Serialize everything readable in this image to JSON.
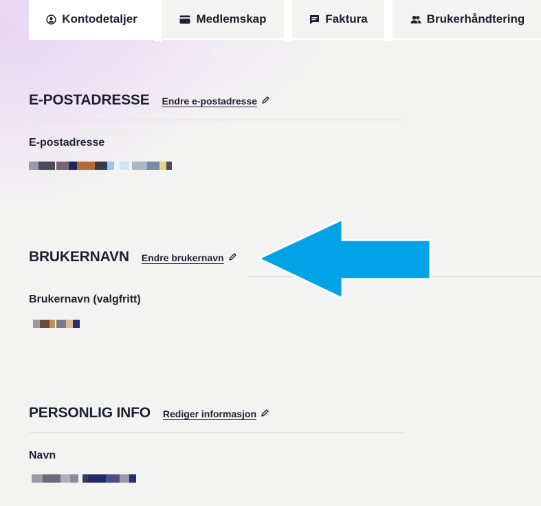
{
  "tabs": [
    {
      "label": "Kontodetaljer",
      "icon": "user-circle-icon",
      "active": true
    },
    {
      "label": "Medlemskap",
      "icon": "credit-card-icon",
      "active": false
    },
    {
      "label": "Faktura",
      "icon": "receipt-icon",
      "active": false
    },
    {
      "label": "Brukerhåndtering",
      "icon": "users-icon",
      "active": false
    }
  ],
  "email_section": {
    "title": "E-POSTADRESSE",
    "edit_label": "Endre e-postadresse",
    "field_label": "E-postadresse"
  },
  "username_section": {
    "title": "BRUKERNAVN",
    "edit_label": "Endre brukernavn",
    "field_label": "Brukernavn (valgfritt)"
  },
  "personal_section": {
    "title": "PERSONLIG INFO",
    "edit_label": "Rediger informasjon",
    "field_label": "Navn"
  },
  "colors": {
    "arrow": "#00a3e6",
    "text": "#1f1f33",
    "background": "#f3f3f2"
  }
}
